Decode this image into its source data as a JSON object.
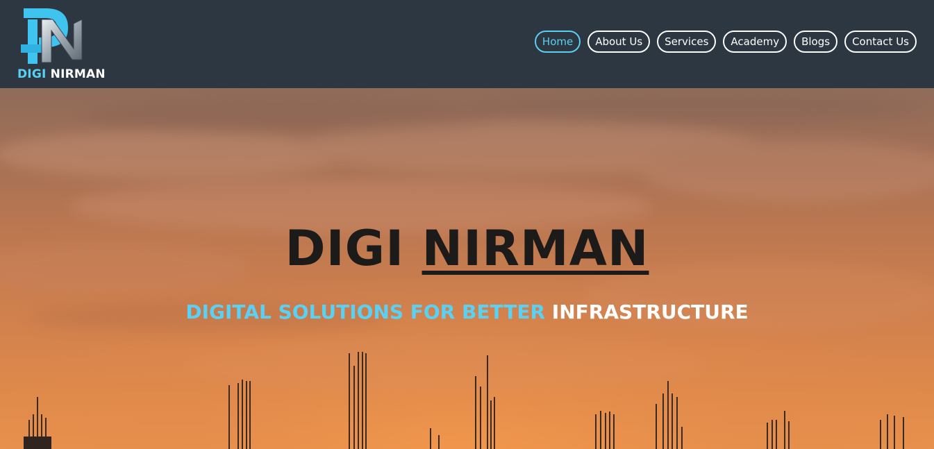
{
  "brand": {
    "name_part1": "DIGI",
    "name_part2": "NIRMAN",
    "accent_color": "#5ad0f2",
    "logo_icon": "dn-monogram-icon"
  },
  "nav": {
    "items": [
      {
        "label": "Home",
        "active": true
      },
      {
        "label": "About Us",
        "active": false
      },
      {
        "label": "Services",
        "active": false
      },
      {
        "label": "Academy",
        "active": false
      },
      {
        "label": "Blogs",
        "active": false
      },
      {
        "label": "Contact Us",
        "active": false
      }
    ]
  },
  "hero": {
    "title_part1": "DIGI",
    "title_part2": "NIRMAN",
    "subtitle_part1": "DIGITAL SOLUTIONS FOR BETTER",
    "subtitle_part2": "INFRASTRUCTURE",
    "background": "sunset-construction-rebar-image"
  }
}
